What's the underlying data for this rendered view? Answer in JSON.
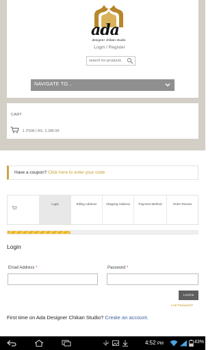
{
  "header": {
    "logo_brand": "ada",
    "logo_tagline": "designer chikan studio",
    "login_register": "Login / Register",
    "search_placeholder": "search for products",
    "nav_label": "NAVIGATE TO..."
  },
  "cart": {
    "title": "CART",
    "summary": "1 ITEM | RS. 2,280.00"
  },
  "coupon": {
    "prompt": "Have a coupon?",
    "link": "Click here to enter your code"
  },
  "steps": [
    {
      "label": ""
    },
    {
      "label": "Login"
    },
    {
      "label": "Billing Address"
    },
    {
      "label": "Shipping Address"
    },
    {
      "label": "Payment Method"
    },
    {
      "label": "Order Review"
    }
  ],
  "progress_fraction": 0.33,
  "login": {
    "heading": "Login",
    "email_label": "Email Address",
    "password_label": "Password",
    "required_mark": "*",
    "button": "LOGIN",
    "lost_password": "Lost Password?",
    "first_time_prefix": "First time on Ada Designer Chikan Studio?",
    "create_account": "Create an account."
  },
  "status_bar": {
    "time": "4:52",
    "ampm": "PM",
    "battery": "43%"
  },
  "colors": {
    "accent_gold": "#c79b2d",
    "progress_yellow": "#e8b21a",
    "nav_gray": "#8f8f8f",
    "page_beige": "#d3cec6"
  }
}
